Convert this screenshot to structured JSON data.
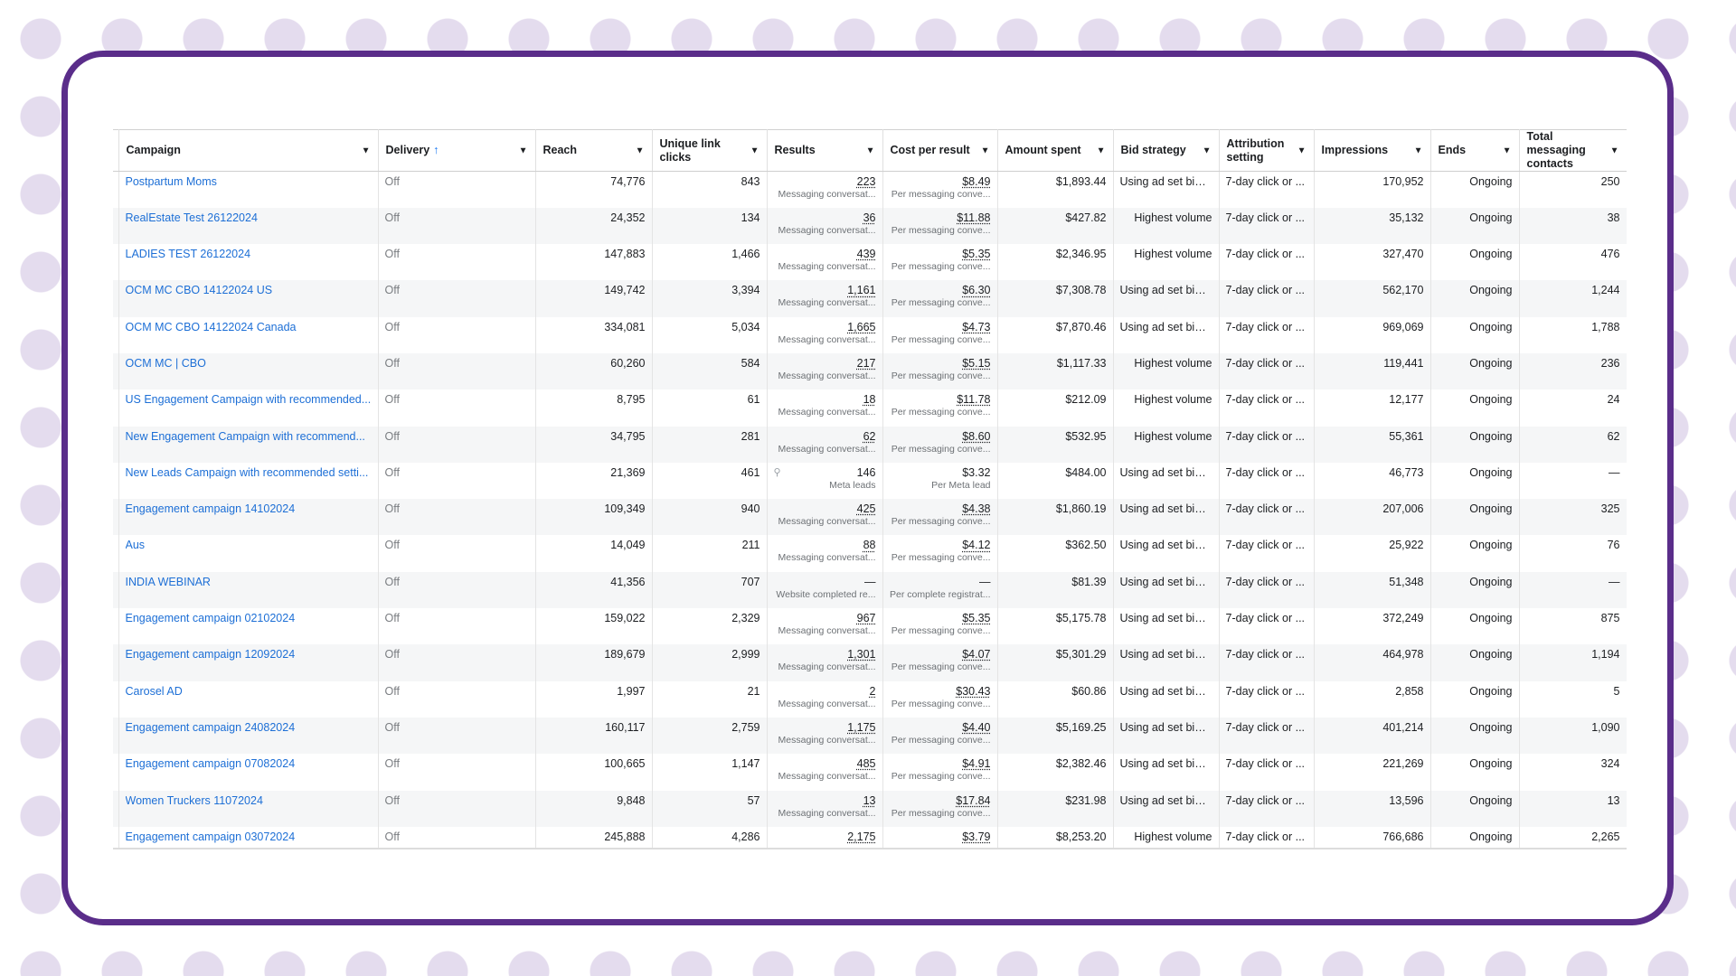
{
  "columns": {
    "campaign": "Campaign",
    "delivery": "Delivery",
    "reach": "Reach",
    "unique_link_clicks": "Unique link clicks",
    "results": "Results",
    "cost_per_result": "Cost per result",
    "amount_spent": "Amount spent",
    "bid_strategy": "Bid strategy",
    "attribution_setting": "Attribution setting",
    "impressions": "Impressions",
    "ends": "Ends",
    "total_messaging_contacts": "Total messaging contacts"
  },
  "icons": {
    "dropdown": "caret-down-icon",
    "sort": "sort-ascending-icon",
    "lead": "lead-form-icon"
  },
  "colors": {
    "frame": "#5a2d8a",
    "link": "#1d6fd6",
    "sort_arrow": "#1877f2"
  },
  "rows": [
    {
      "campaign": "Postpartum Moms",
      "delivery": "Off",
      "reach": "74,776",
      "clicks": "843",
      "results": "223",
      "results_sub": "Messaging conversat...",
      "cost": "$8.49",
      "cost_sub": "Per messaging conve...",
      "spent": "$1,893.44",
      "bid": "Using ad set bid ...",
      "attribution": "7-day click or ...",
      "impressions": "170,952",
      "ends": "Ongoing",
      "contacts": "250"
    },
    {
      "campaign": "RealEstate Test 26122024",
      "delivery": "Off",
      "reach": "24,352",
      "clicks": "134",
      "results": "36",
      "results_sub": "Messaging conversat...",
      "cost": "$11.88",
      "cost_sub": "Per messaging conve...",
      "spent": "$427.82",
      "bid": "Highest volume",
      "attribution": "7-day click or ...",
      "impressions": "35,132",
      "ends": "Ongoing",
      "contacts": "38"
    },
    {
      "campaign": "LADIES TEST 26122024",
      "delivery": "Off",
      "reach": "147,883",
      "clicks": "1,466",
      "results": "439",
      "results_sub": "Messaging conversat...",
      "cost": "$5.35",
      "cost_sub": "Per messaging conve...",
      "spent": "$2,346.95",
      "bid": "Highest volume",
      "attribution": "7-day click or ...",
      "impressions": "327,470",
      "ends": "Ongoing",
      "contacts": "476"
    },
    {
      "campaign": "OCM MC CBO 14122024 US",
      "delivery": "Off",
      "reach": "149,742",
      "clicks": "3,394",
      "results": "1,161",
      "results_sub": "Messaging conversat...",
      "cost": "$6.30",
      "cost_sub": "Per messaging conve...",
      "spent": "$7,308.78",
      "bid": "Using ad set bid ...",
      "attribution": "7-day click or ...",
      "impressions": "562,170",
      "ends": "Ongoing",
      "contacts": "1,244"
    },
    {
      "campaign": "OCM MC CBO 14122024 Canada",
      "delivery": "Off",
      "reach": "334,081",
      "clicks": "5,034",
      "results": "1,665",
      "results_sub": "Messaging conversat...",
      "cost": "$4.73",
      "cost_sub": "Per messaging conve...",
      "spent": "$7,870.46",
      "bid": "Using ad set bid ...",
      "attribution": "7-day click or ...",
      "impressions": "969,069",
      "ends": "Ongoing",
      "contacts": "1,788"
    },
    {
      "campaign": "OCM MC | CBO",
      "delivery": "Off",
      "reach": "60,260",
      "clicks": "584",
      "results": "217",
      "results_sub": "Messaging conversat...",
      "cost": "$5.15",
      "cost_sub": "Per messaging conve...",
      "spent": "$1,117.33",
      "bid": "Highest volume",
      "attribution": "7-day click or ...",
      "impressions": "119,441",
      "ends": "Ongoing",
      "contacts": "236"
    },
    {
      "campaign": "US Engagement Campaign with recommended...",
      "delivery": "Off",
      "reach": "8,795",
      "clicks": "61",
      "results": "18",
      "results_sub": "Messaging conversat...",
      "cost": "$11.78",
      "cost_sub": "Per messaging conve...",
      "spent": "$212.09",
      "bid": "Highest volume",
      "attribution": "7-day click or ...",
      "impressions": "12,177",
      "ends": "Ongoing",
      "contacts": "24"
    },
    {
      "campaign": "New Engagement Campaign with recommend...",
      "delivery": "Off",
      "reach": "34,795",
      "clicks": "281",
      "results": "62",
      "results_sub": "Messaging conversat...",
      "cost": "$8.60",
      "cost_sub": "Per messaging conve...",
      "spent": "$532.95",
      "bid": "Highest volume",
      "attribution": "7-day click or ...",
      "impressions": "55,361",
      "ends": "Ongoing",
      "contacts": "62"
    },
    {
      "campaign": "New Leads Campaign with recommended setti...",
      "delivery": "Off",
      "reach": "21,369",
      "clicks": "461",
      "results": "146",
      "results_sub": "Meta leads",
      "cost": "$3.32",
      "cost_sub": "Per Meta lead",
      "spent": "$484.00",
      "bid": "Using ad set bid ...",
      "attribution": "7-day click or ...",
      "impressions": "46,773",
      "ends": "Ongoing",
      "contacts": "—"
    },
    {
      "campaign": "Engagement campaign 14102024",
      "delivery": "Off",
      "reach": "109,349",
      "clicks": "940",
      "results": "425",
      "results_sub": "Messaging conversat...",
      "cost": "$4.38",
      "cost_sub": "Per messaging conve...",
      "spent": "$1,860.19",
      "bid": "Using ad set bid ...",
      "attribution": "7-day click or ...",
      "impressions": "207,006",
      "ends": "Ongoing",
      "contacts": "325"
    },
    {
      "campaign": "Aus",
      "delivery": "Off",
      "reach": "14,049",
      "clicks": "211",
      "results": "88",
      "results_sub": "Messaging conversat...",
      "cost": "$4.12",
      "cost_sub": "Per messaging conve...",
      "spent": "$362.50",
      "bid": "Using ad set bid ...",
      "attribution": "7-day click or ...",
      "impressions": "25,922",
      "ends": "Ongoing",
      "contacts": "76"
    },
    {
      "campaign": "INDIA WEBINAR",
      "delivery": "Off",
      "reach": "41,356",
      "clicks": "707",
      "results": "—",
      "results_sub": "Website completed re...",
      "cost": "—",
      "cost_sub": "Per complete registrat...",
      "spent": "$81.39",
      "bid": "Using ad set bid ...",
      "attribution": "7-day click or ...",
      "impressions": "51,348",
      "ends": "Ongoing",
      "contacts": "—"
    },
    {
      "campaign": "Engagement campaign 02102024",
      "delivery": "Off",
      "reach": "159,022",
      "clicks": "2,329",
      "results": "967",
      "results_sub": "Messaging conversat...",
      "cost": "$5.35",
      "cost_sub": "Per messaging conve...",
      "spent": "$5,175.78",
      "bid": "Using ad set bid ...",
      "attribution": "7-day click or ...",
      "impressions": "372,249",
      "ends": "Ongoing",
      "contacts": "875"
    },
    {
      "campaign": "Engagement campaign 12092024",
      "delivery": "Off",
      "reach": "189,679",
      "clicks": "2,999",
      "results": "1,301",
      "results_sub": "Messaging conversat...",
      "cost": "$4.07",
      "cost_sub": "Per messaging conve...",
      "spent": "$5,301.29",
      "bid": "Using ad set bid ...",
      "attribution": "7-day click or ...",
      "impressions": "464,978",
      "ends": "Ongoing",
      "contacts": "1,194"
    },
    {
      "campaign": "Carosel AD",
      "delivery": "Off",
      "reach": "1,997",
      "clicks": "21",
      "results": "2",
      "results_sub": "Messaging conversat...",
      "cost": "$30.43",
      "cost_sub": "Per messaging conve...",
      "spent": "$60.86",
      "bid": "Using ad set bid ...",
      "attribution": "7-day click or ...",
      "impressions": "2,858",
      "ends": "Ongoing",
      "contacts": "5"
    },
    {
      "campaign": "Engagement campaign 24082024",
      "delivery": "Off",
      "reach": "160,117",
      "clicks": "2,759",
      "results": "1,175",
      "results_sub": "Messaging conversat...",
      "cost": "$4.40",
      "cost_sub": "Per messaging conve...",
      "spent": "$5,169.25",
      "bid": "Using ad set bid ...",
      "attribution": "7-day click or ...",
      "impressions": "401,214",
      "ends": "Ongoing",
      "contacts": "1,090"
    },
    {
      "campaign": "Engagement campaign 07082024",
      "delivery": "Off",
      "reach": "100,665",
      "clicks": "1,147",
      "results": "485",
      "results_sub": "Messaging conversat...",
      "cost": "$4.91",
      "cost_sub": "Per messaging conve...",
      "spent": "$2,382.46",
      "bid": "Using ad set bid ...",
      "attribution": "7-day click or ...",
      "impressions": "221,269",
      "ends": "Ongoing",
      "contacts": "324"
    },
    {
      "campaign": "Women Truckers 11072024",
      "delivery": "Off",
      "reach": "9,848",
      "clicks": "57",
      "results": "13",
      "results_sub": "Messaging conversat...",
      "cost": "$17.84",
      "cost_sub": "Per messaging conve...",
      "spent": "$231.98",
      "bid": "Using ad set bid ...",
      "attribution": "7-day click or ...",
      "impressions": "13,596",
      "ends": "Ongoing",
      "contacts": "13"
    },
    {
      "campaign": "Engagement campaign 03072024",
      "delivery": "Off",
      "reach": "245,888",
      "clicks": "4,286",
      "results": "2,175",
      "results_sub": "",
      "cost": "$3.79",
      "cost_sub": "",
      "spent": "$8,253.20",
      "bid": "Highest volume",
      "attribution": "7-day click or ...",
      "impressions": "766,686",
      "ends": "Ongoing",
      "contacts": "2,265"
    }
  ]
}
